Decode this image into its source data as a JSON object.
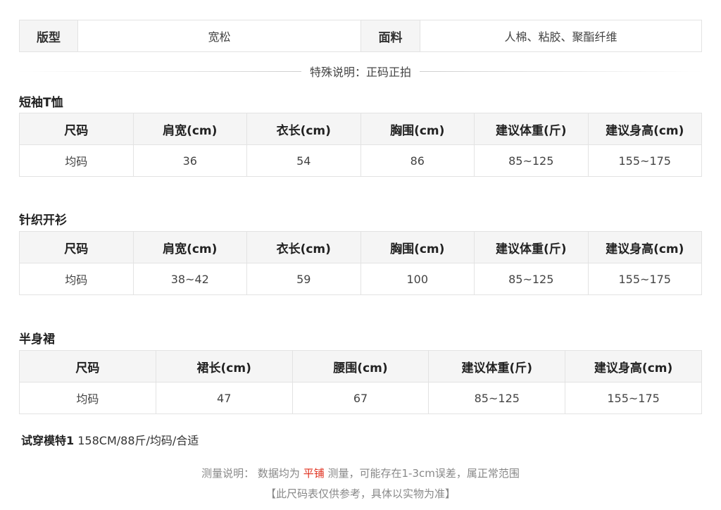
{
  "info": {
    "fit_label": "版型",
    "fit_value": "宽松",
    "fabric_label": "面料",
    "fabric_value": "人棉、粘胶、聚酯纤维"
  },
  "special_note": "特殊说明：正码正拍",
  "tables": [
    {
      "title": "短袖T恤",
      "headers": [
        "尺码",
        "肩宽(cm)",
        "衣长(cm)",
        "胸围(cm)",
        "建议体重(斤)",
        "建议身高(cm)"
      ],
      "row": [
        "均码",
        "36",
        "54",
        "86",
        "85~125",
        "155~175"
      ]
    },
    {
      "title": "针织开衫",
      "headers": [
        "尺码",
        "肩宽(cm)",
        "衣长(cm)",
        "胸围(cm)",
        "建议体重(斤)",
        "建议身高(cm)"
      ],
      "row": [
        "均码",
        "38~42",
        "59",
        "100",
        "85~125",
        "155~175"
      ]
    },
    {
      "title": "半身裙",
      "headers": [
        "尺码",
        "裙长(cm)",
        "腰围(cm)",
        "建议体重(斤)",
        "建议身高(cm)"
      ],
      "row": [
        "均码",
        "47",
        "67",
        "85~125",
        "155~175"
      ]
    }
  ],
  "model": {
    "label": "试穿模特1",
    "value": "158CM/88斤/均码/合适"
  },
  "measure": {
    "prefix": "测量说明：  数据均为",
    "highlight": "平铺",
    "suffix": "测量，可能存在1-3cm误差，属正常范围"
  },
  "disclaimer": "【此尺码表仅供参考，具体以实物为准】",
  "colors": {
    "highlight": "#e0301e",
    "header_bg": "#f5f5f5",
    "border": "#e3e3e3"
  }
}
